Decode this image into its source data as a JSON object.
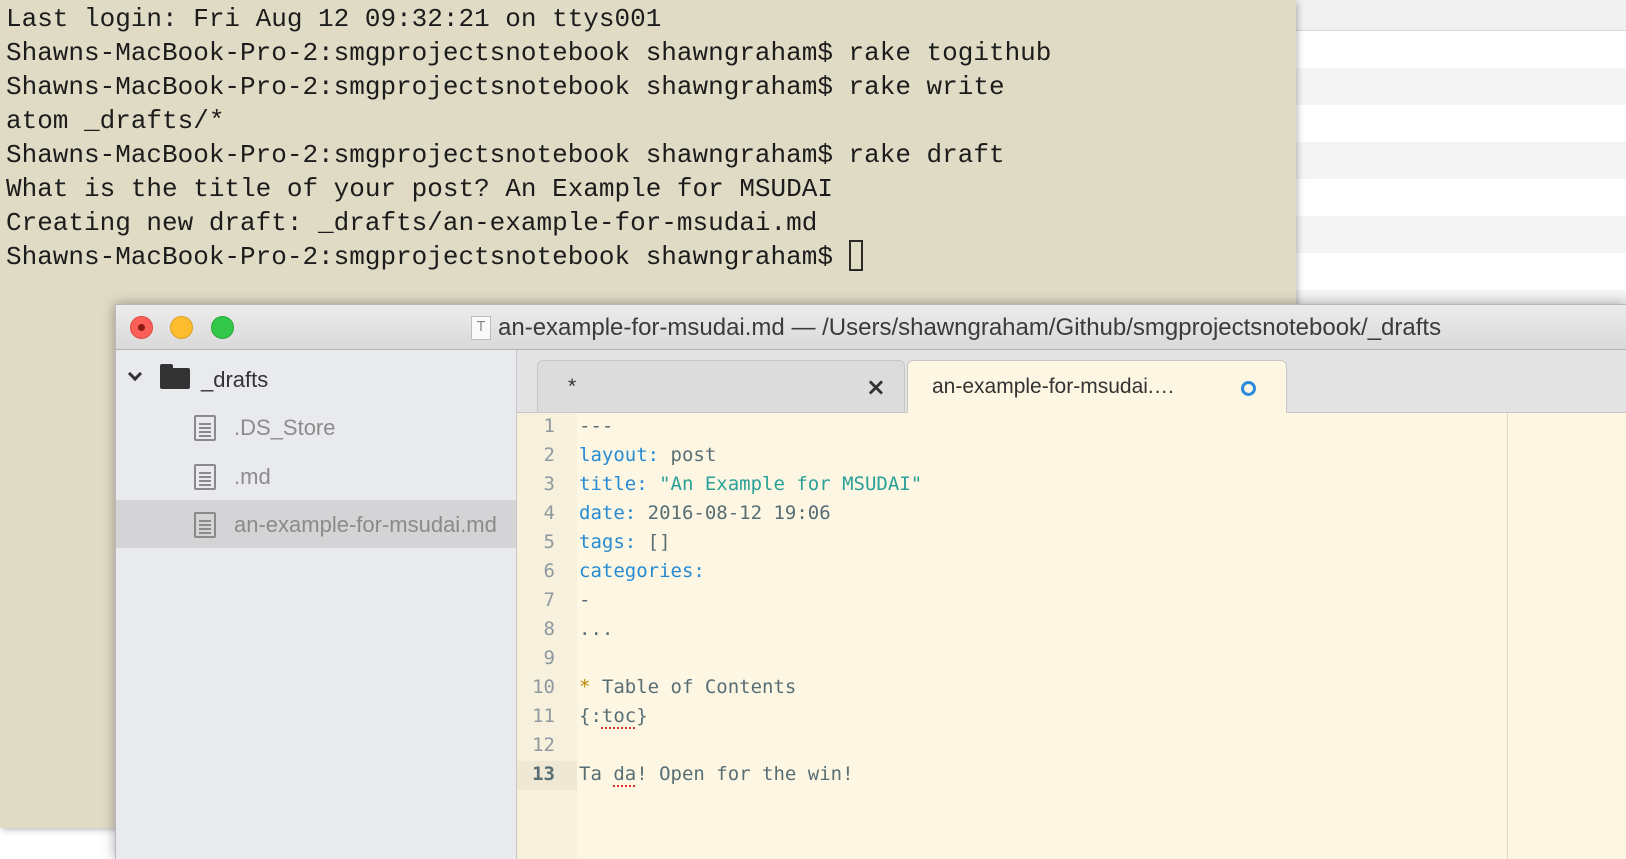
{
  "terminal": {
    "lines": [
      "Last login: Fri Aug 12 09:32:21 on ttys001",
      "Shawns-MacBook-Pro-2:smgprojectsnotebook shawngraham$ rake togithub",
      "Shawns-MacBook-Pro-2:smgprojectsnotebook shawngraham$ rake write",
      "atom _drafts/*",
      "Shawns-MacBook-Pro-2:smgprojectsnotebook shawngraham$ rake draft",
      "What is the title of your post? An Example for MSUDAI",
      "Creating new draft: _drafts/an-example-for-msudai.md"
    ],
    "prompt": "Shawns-MacBook-Pro-2:smgprojectsnotebook shawngraham$ "
  },
  "atom": {
    "window_title": "an-example-for-msudai.md — /Users/shawngraham/Github/smgprojectsnotebook/_drafts",
    "title_icon_letter": "T",
    "tree": {
      "folder": "_drafts",
      "files": [
        ".DS_Store",
        ".md",
        "an-example-for-msudai.md"
      ]
    },
    "tabs": [
      {
        "label": "*",
        "close": "×"
      },
      {
        "label": "an-example-for-msudai.…",
        "modified": true
      }
    ],
    "editor": {
      "lines": [
        {
          "n": "1",
          "segs": [
            {
              "t": "---",
              "c": ""
            }
          ]
        },
        {
          "n": "2",
          "segs": [
            {
              "t": "layout:",
              "c": "k"
            },
            {
              "t": " post",
              "c": ""
            }
          ]
        },
        {
          "n": "3",
          "segs": [
            {
              "t": "title:",
              "c": "k"
            },
            {
              "t": " \"An Example for MSUDAI\"",
              "c": "s"
            }
          ]
        },
        {
          "n": "4",
          "segs": [
            {
              "t": "date:",
              "c": "k"
            },
            {
              "t": " 2016-08-12 19:06",
              "c": ""
            }
          ]
        },
        {
          "n": "5",
          "segs": [
            {
              "t": "tags:",
              "c": "k"
            },
            {
              "t": " []",
              "c": ""
            }
          ]
        },
        {
          "n": "6",
          "segs": [
            {
              "t": "categories:",
              "c": "k"
            }
          ]
        },
        {
          "n": "7",
          "segs": [
            {
              "t": "-",
              "c": ""
            }
          ]
        },
        {
          "n": "8",
          "segs": [
            {
              "t": "...",
              "c": ""
            }
          ]
        },
        {
          "n": "9",
          "segs": []
        },
        {
          "n": "10",
          "segs": [
            {
              "t": "*",
              "c": "star"
            },
            {
              "t": " Table of Contents",
              "c": ""
            }
          ]
        },
        {
          "n": "11",
          "segs": [
            {
              "t": "{:",
              "c": ""
            },
            {
              "t": "toc",
              "c": "spell"
            },
            {
              "t": "}",
              "c": ""
            }
          ]
        },
        {
          "n": "12",
          "segs": []
        },
        {
          "n": "13",
          "segs": [
            {
              "t": "Ta ",
              "c": ""
            },
            {
              "t": "da",
              "c": "spell"
            },
            {
              "t": "! Open for the win!",
              "c": ""
            }
          ]
        }
      ],
      "current_line": "13"
    }
  },
  "colors": {
    "terminal_bg": "#e0dbc5",
    "editor_bg": "#fdf6e3",
    "yaml_key": "#268bd2",
    "yaml_string": "#2aa198",
    "modified_indicator": "#2a8bdd"
  }
}
